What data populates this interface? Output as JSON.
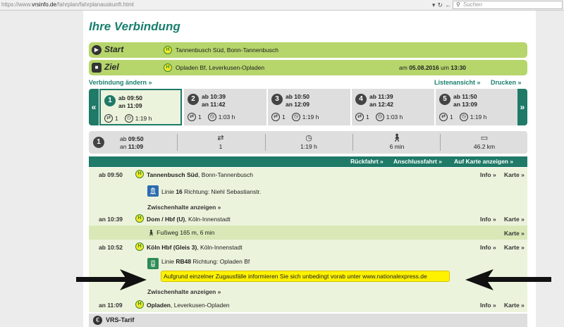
{
  "browser": {
    "url_prefix": "https://www.",
    "url_domain": "vrsinfo.de",
    "url_path": "/fahrplan/fahrplanauskunft.html",
    "search_placeholder": "Suchen"
  },
  "page": {
    "title": "Ihre Verbindung"
  },
  "start": {
    "label": "Start",
    "place": "Tannenbusch Süd, Bonn-Tannenbusch"
  },
  "ziel": {
    "label": "Ziel",
    "place": "Opladen Bf, Leverkusen-Opladen",
    "date_prefix": "am",
    "date": "05.08.2016",
    "time_prefix": "um",
    "time": "13:30"
  },
  "links": {
    "verbindung_aendern": "Verbindung ändern »",
    "listenansicht": "Listenansicht »",
    "drucken": "Drucken »"
  },
  "carousel": {
    "prev": "«",
    "next": "»",
    "cards": [
      {
        "num": "1",
        "dep": "ab 09:50",
        "arr": "an 11:09",
        "changes": "1",
        "duration": "1:19 h"
      },
      {
        "num": "2",
        "dep": "ab 10:39",
        "arr": "an 11:42",
        "changes": "1",
        "duration": "1:03 h"
      },
      {
        "num": "3",
        "dep": "ab 10:50",
        "arr": "an 12:09",
        "changes": "1",
        "duration": "1:19 h"
      },
      {
        "num": "4",
        "dep": "ab 11:39",
        "arr": "an 12:42",
        "changes": "1",
        "duration": "1:03 h"
      },
      {
        "num": "5",
        "dep": "ab 11:50",
        "arr": "an 13:09",
        "changes": "1",
        "duration": "1:19 h"
      }
    ]
  },
  "summary": {
    "num": "1",
    "dep_prefix": "ab",
    "dep": "09:50",
    "arr_prefix": "an",
    "arr": "11:09",
    "changes": "1",
    "duration": "1:19 h",
    "walk": "6 min",
    "distance": "46.2 km"
  },
  "actions": {
    "rueckfahrt": "Rückfahrt »",
    "anschlussfahrt": "Anschlussfahrt »",
    "auf_karte": "Auf Karte anzeigen »"
  },
  "legs": {
    "info": "Info »",
    "karte": "Karte »",
    "stop1": {
      "time": "ab 09:50",
      "name": "Tannenbusch Süd",
      "city": ", Bonn-Tannenbusch"
    },
    "line1": {
      "pre": "Linie ",
      "num": "16",
      "post": " Richtung: Niehl Sebastianstr."
    },
    "zwischenhalte": "Zwischenhalte anzeigen »",
    "stop2": {
      "time": "an 10:39",
      "name": "Dom / Hbf (U)",
      "city": ", Köln-Innenstadt"
    },
    "walk": "Fußweg 165 m, 6 min",
    "stop3": {
      "time": "ab 10:52",
      "name": "Köln Hbf (Gleis 3)",
      "city": ", Köln-Innenstadt"
    },
    "line2": {
      "pre": "Linie ",
      "num": "RB48",
      "post": " Richtung: Opladen Bf"
    },
    "notice": "Aufgrund einzelner Zugausfälle informieren Sie sich unbedingt vorab unter www.nationalexpress.de",
    "stop4": {
      "time": "an 11:09",
      "name": "Opladen",
      "city": ", Leverkusen-Opladen"
    }
  },
  "tarif": {
    "label": "VRS-Tarif"
  }
}
